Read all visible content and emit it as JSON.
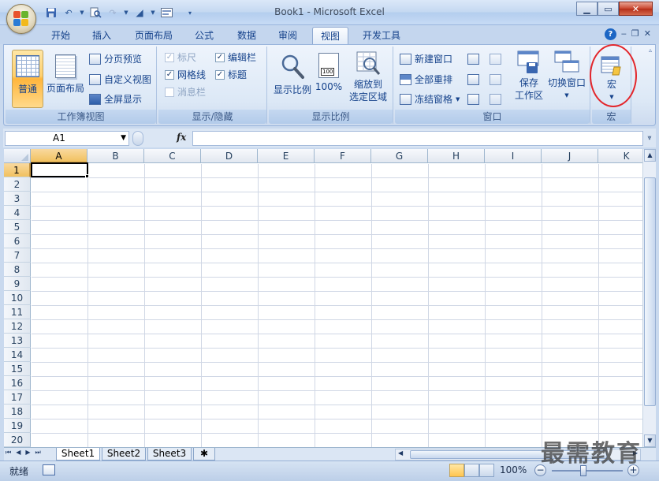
{
  "window": {
    "title": "Book1 - Microsoft Excel"
  },
  "ribbon_tabs": [
    "开始",
    "插入",
    "页面布局",
    "公式",
    "数据",
    "审阅",
    "视图",
    "开发工具"
  ],
  "active_tab": "视图",
  "groups": {
    "workbook_views": {
      "label": "工作簿视图",
      "normal": "普通",
      "page_layout": "页面布局",
      "page_break_preview": "分页预览",
      "custom_views": "自定义视图",
      "full_screen": "全屏显示"
    },
    "show_hide": {
      "label": "显示/隐藏",
      "ruler": "标尺",
      "formula_bar": "编辑栏",
      "gridlines": "网格线",
      "headings": "标题",
      "message_bar": "消息栏"
    },
    "zoom": {
      "label": "显示比例",
      "zoom": "显示比例",
      "zoom_100": "100%",
      "zoom_selection_line1": "缩放到",
      "zoom_selection_line2": "选定区域"
    },
    "window": {
      "label": "窗口",
      "new_window": "新建窗口",
      "arrange_all": "全部重排",
      "freeze_panes": "冻结窗格",
      "save_workspace_line1": "保存",
      "save_workspace_line2": "工作区",
      "switch_windows": "切换窗口"
    },
    "macros": {
      "label": "宏",
      "macros": "宏"
    }
  },
  "formula_bar": {
    "name_box": "A1",
    "fx": "fx",
    "value": ""
  },
  "columns": [
    "A",
    "B",
    "C",
    "D",
    "E",
    "F",
    "G",
    "H",
    "I",
    "J",
    "K"
  ],
  "rows": [
    "1",
    "2",
    "3",
    "4",
    "5",
    "6",
    "7",
    "8",
    "9",
    "10",
    "11",
    "12",
    "13",
    "14",
    "15",
    "16",
    "17",
    "18",
    "19",
    "20"
  ],
  "sheets": [
    "Sheet1",
    "Sheet2",
    "Sheet3"
  ],
  "status": {
    "mode": "就绪",
    "zoom": "100%",
    "zoom_level_percent": 100
  },
  "watermark": "最需教育",
  "colors": {
    "highlight_circle": "#e3262b",
    "selected_header": "#f1c15f"
  }
}
